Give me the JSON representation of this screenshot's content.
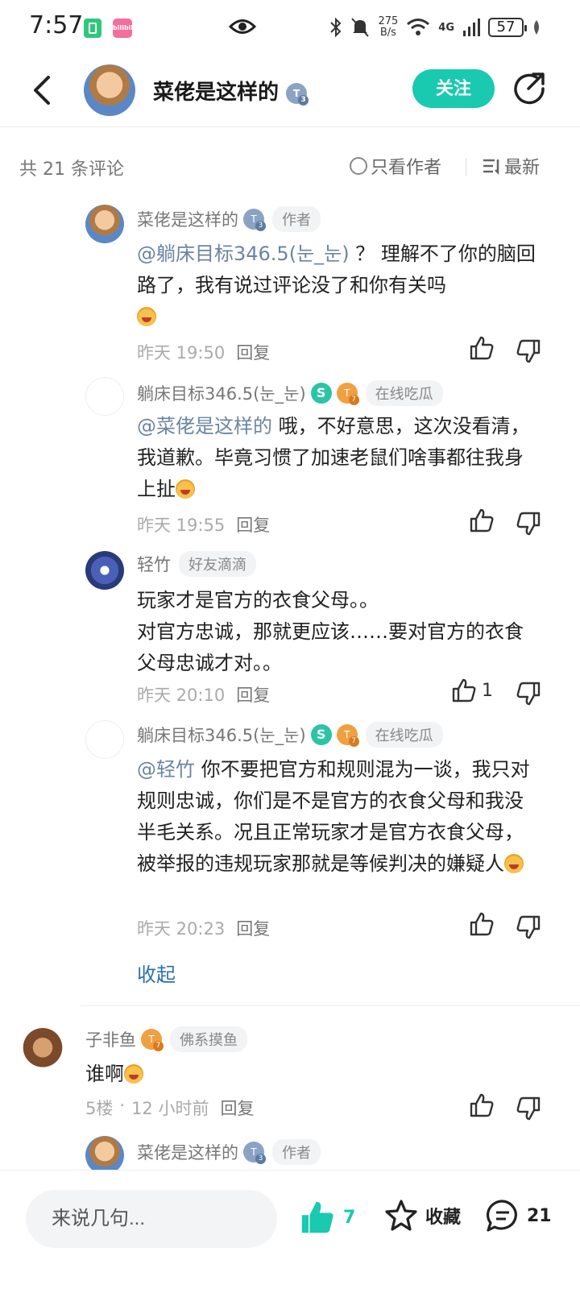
{
  "status_bar": {
    "time": "7:57",
    "app_label": "bilibili",
    "net_speed_top": "275",
    "net_speed_bottom": "B/s",
    "network": "4G",
    "battery": "57"
  },
  "header": {
    "username": "菜佬是这样的",
    "level": "3",
    "follow_label": "关注"
  },
  "filter": {
    "count_label": "共 21 条评论",
    "only_author_label": "只看作者",
    "sort_label": "最新"
  },
  "comments": [
    {
      "username": "菜佬是这样的",
      "level": "3",
      "tag": "作者",
      "mention": "@躺床目标346.5(눈_눈)",
      "text": " ？ 理解不了你的脑回路了，我有说过评论没了和你有关吗",
      "time": "昨天 19:50",
      "reply": "回复",
      "likes": ""
    },
    {
      "username": "躺床目标346.5(눈_눈)",
      "level": "7",
      "tag": "在线吃瓜",
      "mention": "@菜佬是这样的",
      "text": " 哦，不好意思，这次没看清，我道歉。毕竟习惯了加速老鼠们啥事都往我身上扯",
      "time": "昨天 19:55",
      "reply": "回复",
      "likes": ""
    },
    {
      "username": "轻竹",
      "tag": "好友滴滴",
      "line1": "玩家才是官方的衣食父母。。",
      "line2": "对官方忠诚，那就更应该……要对官方的衣食父母忠诚才对。。",
      "time": "昨天 20:10",
      "reply": "回复",
      "likes": "1"
    },
    {
      "username": "躺床目标346.5(눈_눈)",
      "level": "7",
      "tag": "在线吃瓜",
      "mention": "@轻竹",
      "text": " 你不要把官方和规则混为一谈，我只对规则忠诚，你们是不是官方的衣食父母和我没半毛关系。况且正常玩家才是官方衣食父母，被举报的违规玩家那就是等候判决的嫌疑人",
      "time": "昨天 20:23",
      "reply": "回复",
      "likes": ""
    }
  ],
  "collapse_label": "收起",
  "floor_comment": {
    "username": "子非鱼",
    "level": "7",
    "tag": "佛系摸鱼",
    "text": "谁啊",
    "floor": "5楼",
    "dot": "·",
    "time": "12 小时前",
    "reply": "回复"
  },
  "next_reply": {
    "username": "菜佬是这样的",
    "level": "3",
    "tag": "作者"
  },
  "bottom_bar": {
    "input_placeholder": "来说几句...",
    "like_count": "7",
    "fav_label": "收藏",
    "comment_count": "21"
  },
  "colors": {
    "accent": "#19c9b0",
    "mention": "#6b84a3",
    "link": "#2c6fb0"
  }
}
